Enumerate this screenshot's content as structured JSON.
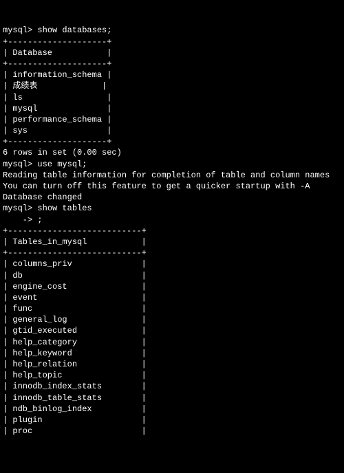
{
  "prompt": "mysql>",
  "cont_prompt": "    -> ",
  "cmd_show_db": "show databases;",
  "db_table": {
    "border_top": "+--------------------+",
    "header": "| Database           |",
    "border_mid": "+--------------------+",
    "rows": [
      "| information_schema |",
      "| 成绩表             |",
      "| ls                 |",
      "| mysql              |",
      "| performance_schema |",
      "| sys                |"
    ],
    "border_bot": "+--------------------+"
  },
  "rows_in_set": "6 rows in set (0.00 sec)",
  "blank": "",
  "cmd_use": "use mysql;",
  "msg_reading": "Reading table information for completion of table and column names",
  "msg_turnoff": "You can turn off this feature to get a quicker startup with -A",
  "msg_dbchanged": "Database changed",
  "cmd_show_tables": "show tables",
  "cont_semi": ";",
  "tables_table": {
    "border_top": "+---------------------------+",
    "header": "| Tables_in_mysql           |",
    "border_mid": "+---------------------------+",
    "rows": [
      "| columns_priv              |",
      "| db                        |",
      "| engine_cost               |",
      "| event                     |",
      "| func                      |",
      "| general_log               |",
      "| gtid_executed             |",
      "| help_category             |",
      "| help_keyword              |",
      "| help_relation             |",
      "| help_topic                |",
      "| innodb_index_stats        |",
      "| innodb_table_stats        |",
      "| ndb_binlog_index          |",
      "| plugin                    |",
      "| proc                      |"
    ]
  }
}
